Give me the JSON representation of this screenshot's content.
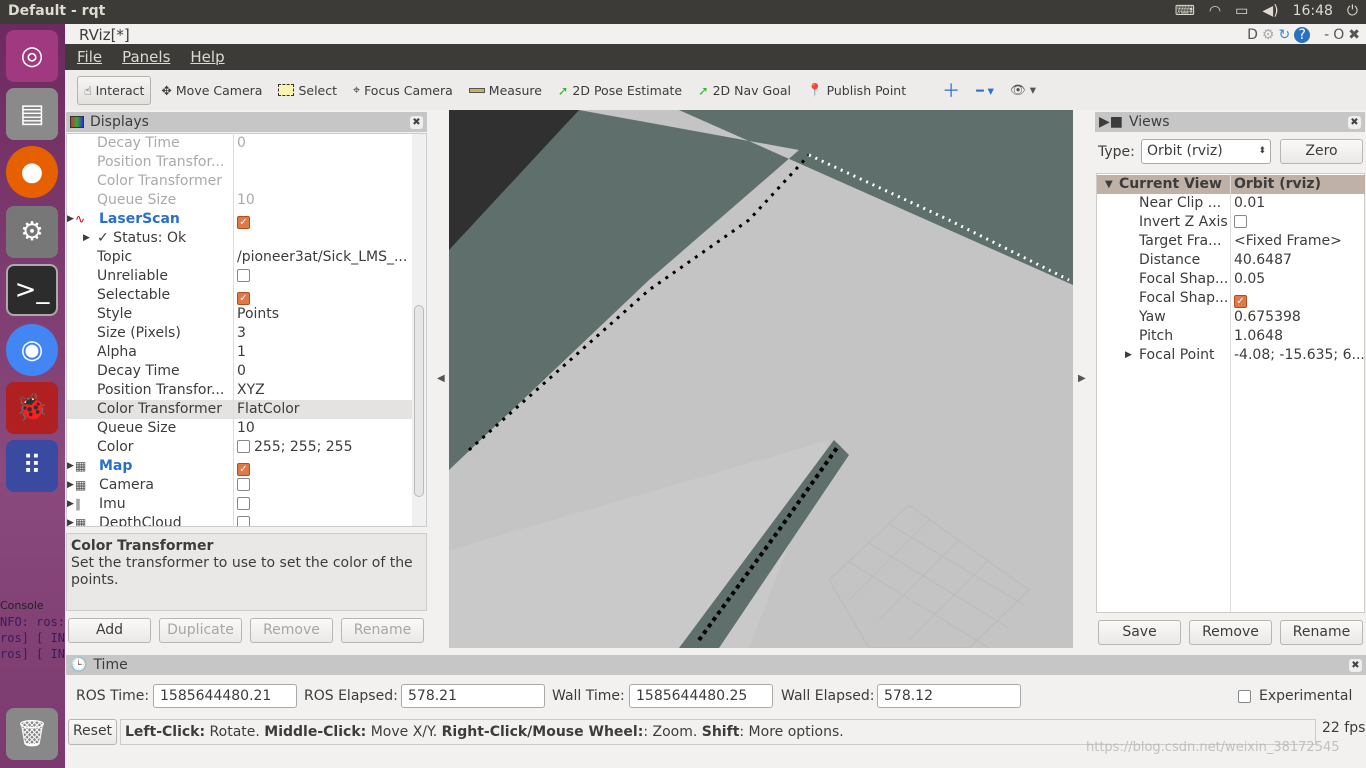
{
  "system": {
    "title": "Default - rqt",
    "clock": "16:48",
    "tray_icons": [
      "keyboard-icon",
      "wifi-icon",
      "battery-icon",
      "volume-icon",
      "power-icon"
    ]
  },
  "launcher": {
    "items": [
      "ubuntu-icon",
      "files-icon",
      "firefox-icon",
      "settings-icon",
      "terminal-icon",
      "chrome-icon",
      "bug-icon",
      "apps-icon",
      "trash-icon"
    ],
    "console_label": "Console",
    "console_lines": [
      "NFO: ros:",
      "ros] [ IN",
      "ros] [ IN"
    ]
  },
  "window": {
    "title": "RViz[*]",
    "controls": [
      "D",
      "-",
      "O"
    ]
  },
  "menu": [
    "File",
    "Panels",
    "Help"
  ],
  "toolbar": [
    {
      "label": "Interact",
      "icon": "hand-icon",
      "active": true
    },
    {
      "label": "Move Camera",
      "icon": "move-camera-icon"
    },
    {
      "label": "Select",
      "icon": "select-icon"
    },
    {
      "label": "Focus Camera",
      "icon": "focus-camera-icon"
    },
    {
      "label": "Measure",
      "icon": "ruler-icon"
    },
    {
      "label": "2D Pose Estimate",
      "icon": "pose-arrow-icon"
    },
    {
      "label": "2D Nav Goal",
      "icon": "nav-goal-arrow-icon"
    },
    {
      "label": "Publish Point",
      "icon": "map-pin-icon"
    }
  ],
  "displays": {
    "title": "Displays",
    "rows": [
      {
        "k": "Decay Time",
        "v": "0",
        "dim": true
      },
      {
        "k": "Position Transfor...",
        "v": "",
        "dim": true
      },
      {
        "k": "Color Transformer",
        "v": "",
        "dim": true
      },
      {
        "k": "Queue Size",
        "v": "10",
        "dim": true
      },
      {
        "k": "LaserScan",
        "cb": true,
        "cat": true,
        "indent": 0
      },
      {
        "k": "✓ Status: Ok",
        "v": "",
        "indent": 1,
        "expand": true
      },
      {
        "k": "Topic",
        "v": "/pioneer3at/Sick_LMS_..."
      },
      {
        "k": "Unreliable",
        "cb": false
      },
      {
        "k": "Selectable",
        "cb": true
      },
      {
        "k": "Style",
        "v": "Points"
      },
      {
        "k": "Size (Pixels)",
        "v": "3"
      },
      {
        "k": "Alpha",
        "v": "1"
      },
      {
        "k": "Decay Time",
        "v": "0"
      },
      {
        "k": "Position Transfor...",
        "v": "XYZ"
      },
      {
        "k": "Color Transformer",
        "v": "FlatColor",
        "sel": true
      },
      {
        "k": "Queue Size",
        "v": "10"
      },
      {
        "k": "Color",
        "v": "255; 255; 255",
        "swatch": true
      },
      {
        "k": "Map",
        "cb": true,
        "cat": true,
        "indent": 0
      },
      {
        "k": "Camera",
        "cb": false,
        "indent": 0
      },
      {
        "k": "Imu",
        "cb": false,
        "indent": 0
      },
      {
        "k": "DepthCloud",
        "cb": false,
        "indent": 0
      }
    ],
    "desc_title": "Color Transformer",
    "desc_text": "Set the transformer to use to set the color of the points.",
    "buttons": {
      "add": "Add",
      "duplicate": "Duplicate",
      "remove": "Remove",
      "rename": "Rename"
    }
  },
  "views": {
    "title": "Views",
    "type_label": "Type:",
    "type_value": "Orbit (rviz)",
    "zero": "Zero",
    "header_k": "Current View",
    "header_v": "Orbit (rviz)",
    "rows": [
      {
        "k": "Near Clip ...",
        "v": "0.01"
      },
      {
        "k": "Invert Z Axis",
        "cb": false
      },
      {
        "k": "Target Fra...",
        "v": "<Fixed Frame>"
      },
      {
        "k": "Distance",
        "v": "40.6487"
      },
      {
        "k": "Focal Shap...",
        "v": "0.05"
      },
      {
        "k": "Focal Shap...",
        "cb": true
      },
      {
        "k": "Yaw",
        "v": "0.675398"
      },
      {
        "k": "Pitch",
        "v": "1.0648"
      },
      {
        "k": "Focal Point",
        "v": "-4.08; -15.635; 6....",
        "expand": true
      }
    ],
    "buttons": {
      "save": "Save",
      "remove": "Remove",
      "rename": "Rename"
    }
  },
  "time": {
    "title": "Time",
    "ros_time_label": "ROS Time:",
    "ros_time": "1585644480.21",
    "ros_elapsed_label": "ROS Elapsed:",
    "ros_elapsed": "578.21",
    "wall_time_label": "Wall Time:",
    "wall_time": "1585644480.25",
    "wall_elapsed_label": "Wall Elapsed:",
    "wall_elapsed": "578.12",
    "experimental": "Experimental"
  },
  "statusbar": {
    "reset": "Reset",
    "help": [
      [
        "Left-Click:",
        " Rotate. "
      ],
      [
        "Middle-Click:",
        " Move X/Y. "
      ],
      [
        "Right-Click/Mouse Wheel:",
        ": Zoom. "
      ],
      [
        "Shift",
        ": More options."
      ]
    ],
    "fps": "22 fps"
  },
  "watermark": "https://blog.csdn.net/weixin_38172545"
}
